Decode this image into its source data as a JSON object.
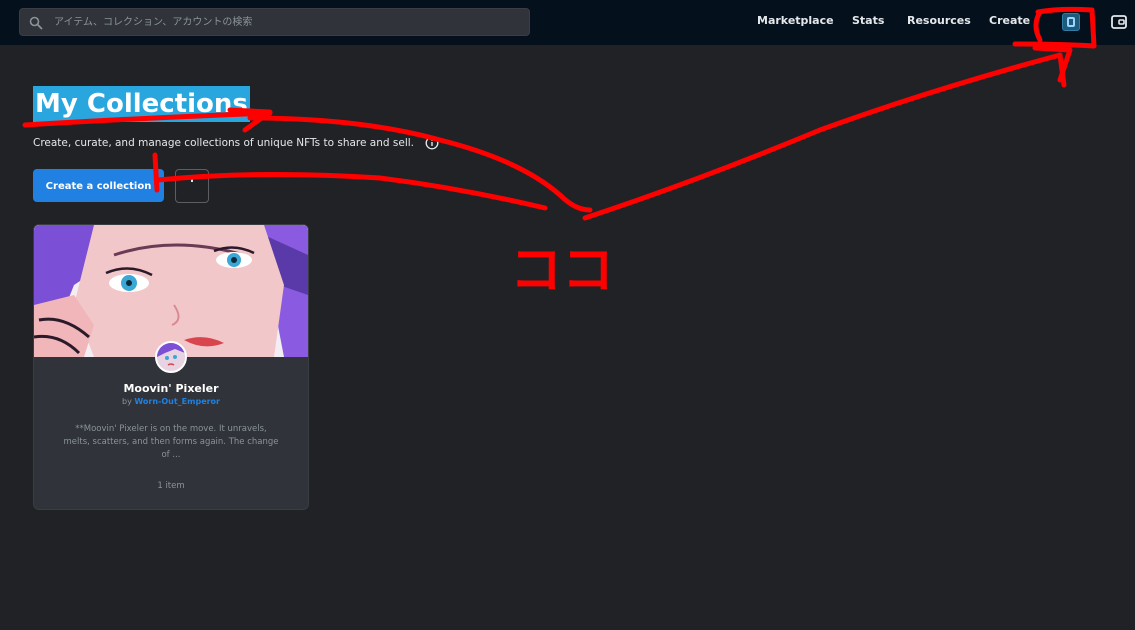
{
  "topbar": {
    "search": {
      "placeholder": "アイテム、コレクション、アカウントの検索",
      "value": ""
    },
    "nav": [
      "Marketplace",
      "Stats",
      "Resources",
      "Create"
    ],
    "icons": {
      "search": "search-icon",
      "profile": "profile-icon",
      "wallet": "wallet-icon"
    }
  },
  "header": {
    "title": "My Collections",
    "subtitle": "Create, curate, and manage collections of unique NFTs to share and sell.",
    "create_button": "Create a collection",
    "more_button_icon": "more-options-icon",
    "info_icon": "info-icon"
  },
  "collections": [
    {
      "name": "Moovin' Pixeler",
      "by_label": "by",
      "author": "Worn-Out_Emperor",
      "description": "**Moovin' Pixeler is on the move. It unravels, melts, scatters, and then forms again. The change of ...",
      "item_count": "1 item"
    }
  ],
  "annotation": {
    "note": "ココ",
    "color": "#ff0000"
  },
  "colors": {
    "accent": "#2081e2",
    "title_highlight": "#2aa6de",
    "topbar_bg": "#04111d",
    "page_bg": "#202225"
  }
}
